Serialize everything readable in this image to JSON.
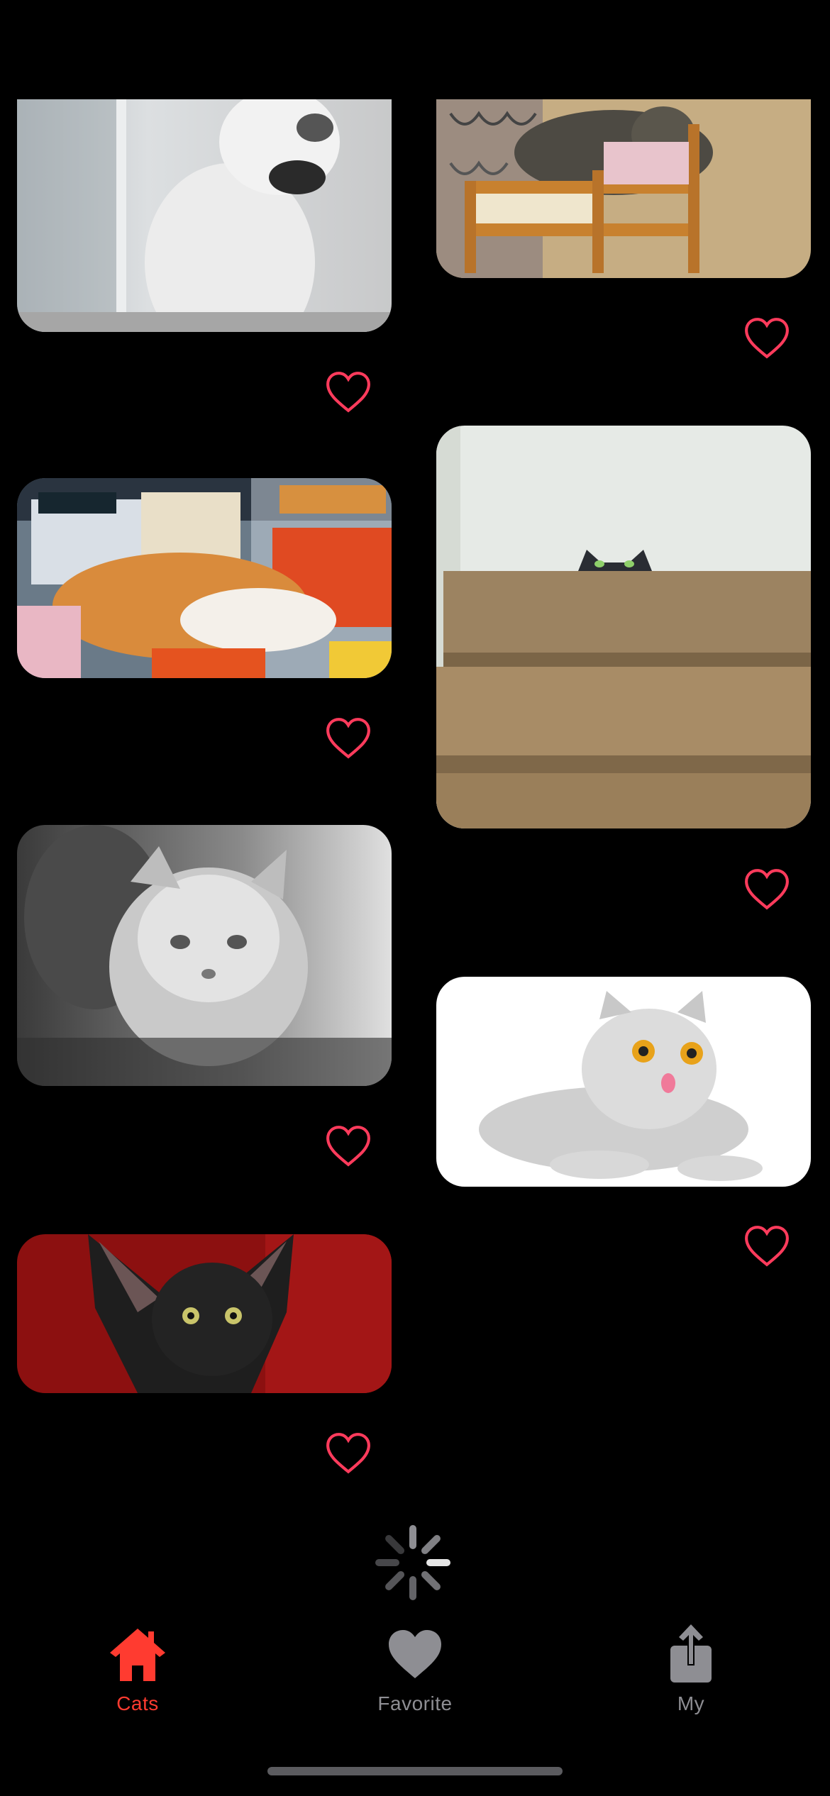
{
  "colors": {
    "accent": "#ff3b30",
    "heart": "#ff3b5c",
    "inactive": "#8e8e93",
    "background": "#000000"
  },
  "gallery": {
    "photos": [
      {
        "name": "photo-white-cat-window",
        "description": "white cat by window"
      },
      {
        "name": "photo-tabby-cat-toy-bed",
        "description": "tabby cat in toy bed"
      },
      {
        "name": "photo-orange-cat-desk",
        "description": "orange cat on desk"
      },
      {
        "name": "photo-cat-peeking-stairs",
        "description": "cat peeking over stairs"
      },
      {
        "name": "photo-fluffy-cat-bw",
        "description": "fluffy cat black and white"
      },
      {
        "name": "photo-persian-cat-white-bg",
        "description": "persian cat on white background"
      },
      {
        "name": "photo-black-oriental-cat",
        "description": "black oriental cat on red"
      }
    ],
    "favorite_icon": "heart-outline-icon"
  },
  "loading": {
    "icon": "activity-spinner-icon"
  },
  "tabs": [
    {
      "label": "Cats",
      "icon": "house-icon",
      "active": true
    },
    {
      "label": "Favorite",
      "icon": "heart-fill-icon",
      "active": false
    },
    {
      "label": "My",
      "icon": "share-icon",
      "active": false
    }
  ]
}
